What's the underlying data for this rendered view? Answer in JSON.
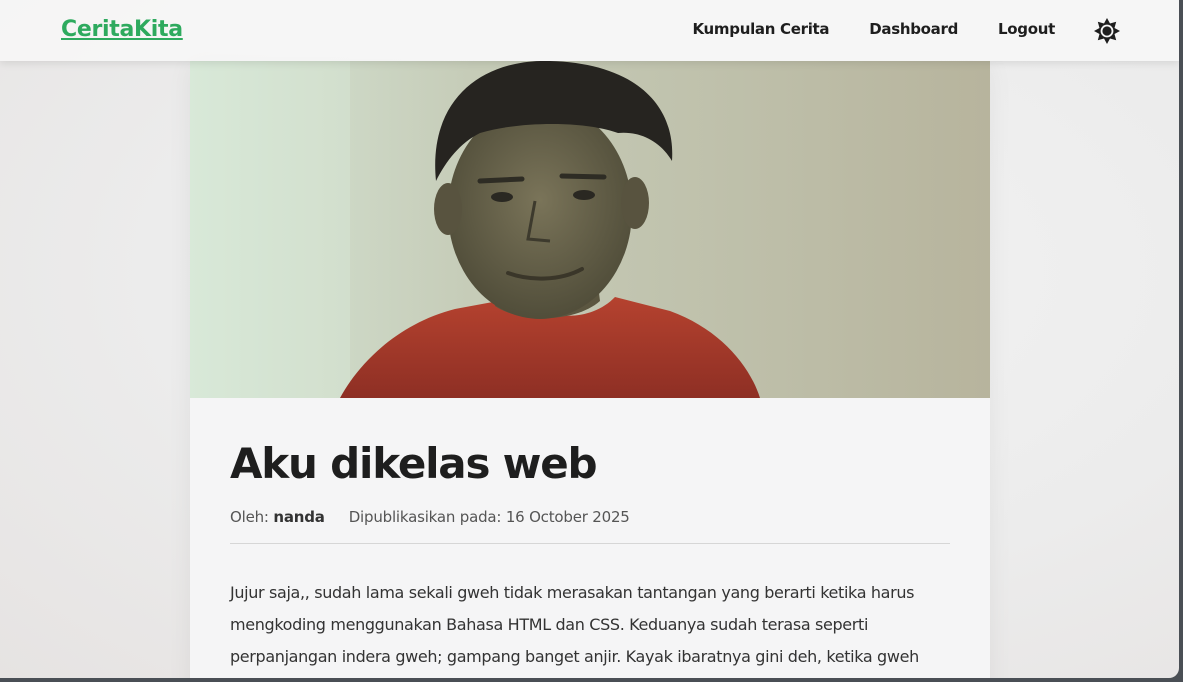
{
  "brand": "CeritaKita",
  "nav": {
    "items": [
      "Kumpulan Cerita",
      "Dashboard",
      "Logout"
    ],
    "theme_icon": "sun-icon"
  },
  "article": {
    "image_icon": "photo-of-boy-in-red-shirt",
    "title": "Aku dikelas web",
    "author_label": "Oleh:",
    "author": "nanda",
    "published": "Dipublikasikan pada: 16 October 2025",
    "body": "Jujur saja,, sudah lama sekali gweh tidak merasakan tantangan yang berarti ketika harus mengkoding menggunakan Bahasa HTML dan CSS. Keduanya sudah terasa seperti perpanjangan indera gweh; gampang banget anjir. Kayak ibaratnya gini deh, ketika gweh"
  },
  "colors": {
    "brand": "#2eaa5e",
    "text": "#1e1e1e",
    "shirt": "#b0392d"
  }
}
